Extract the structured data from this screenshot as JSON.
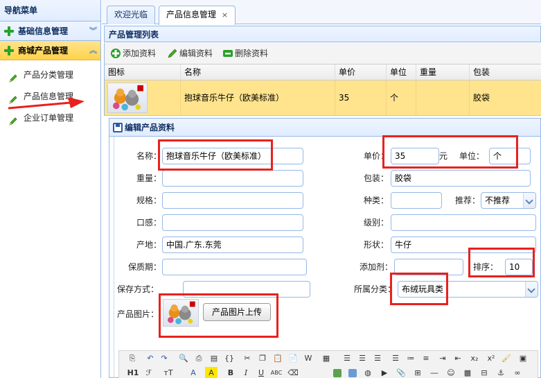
{
  "nav": {
    "header": "导航菜单",
    "sections": [
      {
        "label": "基础信息管理",
        "chevron": "︾",
        "active": false
      },
      {
        "label": "商城产品管理",
        "chevron": "︽",
        "active": true
      }
    ],
    "items": [
      {
        "label": "产品分类管理",
        "icon": "pencil-icon"
      },
      {
        "label": "产品信息管理",
        "icon": "pencil-icon"
      },
      {
        "label": "企业订单管理",
        "icon": "pencil-icon"
      }
    ]
  },
  "tabs": [
    {
      "label": "欢迎光临",
      "selected": false
    },
    {
      "label": "产品信息管理",
      "selected": true,
      "close": "×"
    }
  ],
  "panel": {
    "title": "产品管理列表"
  },
  "toolbar": {
    "add": "添加资料",
    "edit": "编辑资料",
    "delete": "删除资料"
  },
  "grid": {
    "columns": [
      "图标",
      "名称",
      "单价",
      "单位",
      "重量",
      "包装"
    ],
    "rows": [
      {
        "name": "抱球音乐牛仔（欧美标准）",
        "price": "35",
        "unit": "个",
        "weight": "",
        "package": "胶袋"
      }
    ]
  },
  "dialog": {
    "title": "编辑产品资料",
    "labels": {
      "name": "名称：",
      "price": "单价：",
      "yuan": "元",
      "unit": "单位：",
      "weight": "重量：",
      "package": "包装：",
      "spec": "规格：",
      "kind": "种类：",
      "recommend": "推荐：",
      "taste": "口感：",
      "grade": "级别：",
      "origin": "产地：",
      "shape": "形状：",
      "shelf": "保质期：",
      "additive": "添加剂：",
      "sort": "排序：",
      "storage": "保存方式：",
      "category": "所属分类：",
      "image": "产品图片："
    },
    "values": {
      "name": "抱球音乐牛仔（欧美标准）",
      "price": "35",
      "unit": "个",
      "weight": "",
      "package": "胶袋",
      "spec": "",
      "kind": "",
      "recommend": "不推荐",
      "taste": "",
      "grade": "",
      "origin": "中国.广东.东莞",
      "shape": "牛仔",
      "shelf": "",
      "additive": "",
      "sort": "10",
      "storage": "",
      "category": "布绒玩具类"
    },
    "upload": "产品图片上传"
  },
  "editor": {
    "row2_labels": {
      "heading": "H1",
      "font": "ℱ",
      "size": "тT",
      "fontcolor": "A",
      "bgcolor": "A",
      "bold": "B",
      "italic": "I",
      "underline": "U",
      "strike": "ABC",
      "sub": "x₂",
      "sup": "x²"
    }
  },
  "colors": {
    "accent_border": "#95b8e7",
    "highlight": "#e8211d",
    "selected_row": "#ffe48d"
  }
}
